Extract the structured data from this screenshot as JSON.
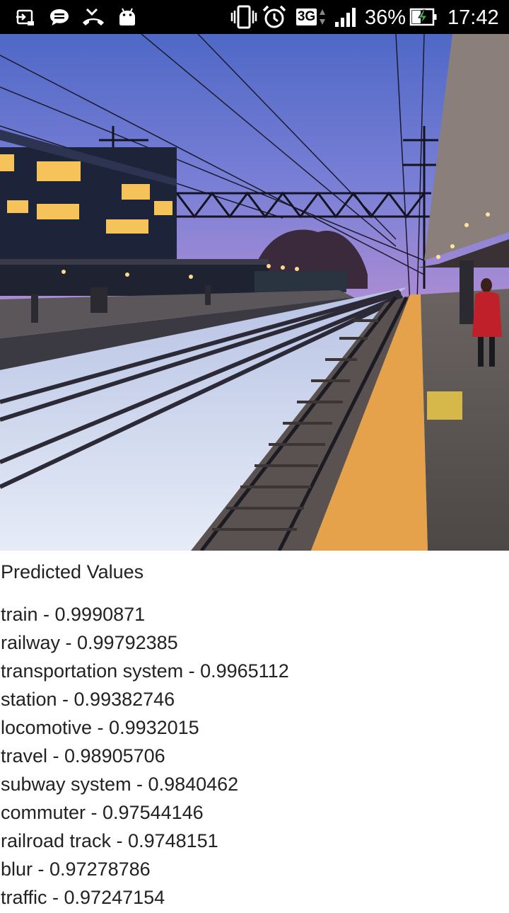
{
  "status_bar": {
    "icons_left": [
      "usb-debug-icon",
      "message-icon",
      "missed-call-icon",
      "android-icon"
    ],
    "icons_right": [
      "vibrate-icon",
      "alarm-icon",
      "3g-data-icon",
      "signal-icon",
      "battery-charging-icon"
    ],
    "network": "3G",
    "battery": "36%",
    "time": "17:42"
  },
  "photo": {
    "description_icon": "train-platform-photo",
    "colors": {
      "sky_top": "#4f68c6",
      "sky_bottom": "#a38ad3",
      "snow": "#dfe5f5",
      "platform_edge": "#e6a24a"
    }
  },
  "results": {
    "heading": "Predicted Values",
    "items": [
      "train - 0.9990871",
      "railway - 0.99792385",
      "transportation system - 0.9965112",
      "station - 0.99382746",
      "locomotive - 0.9932015",
      "travel - 0.98905706",
      "subway system - 0.9840462",
      "commuter - 0.97544146",
      "railroad track - 0.9748151",
      "blur - 0.97278786",
      "traffic - 0.97247154"
    ]
  }
}
